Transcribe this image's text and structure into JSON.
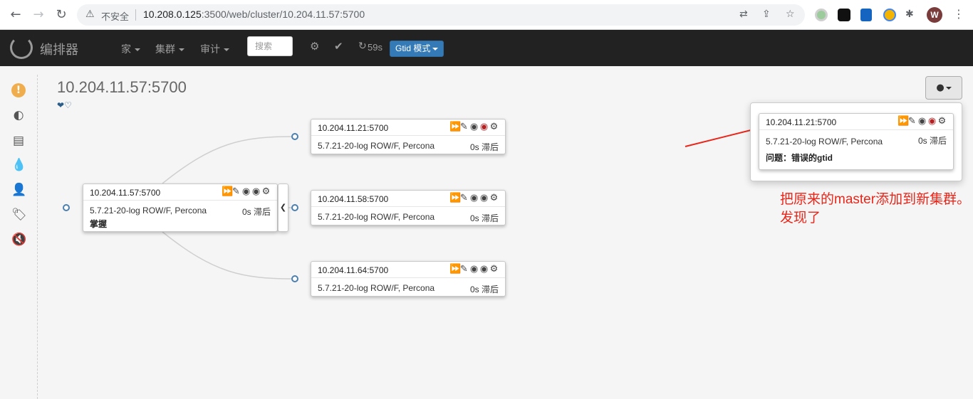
{
  "browser": {
    "insecure_label": "不安全",
    "url_host": "10.208.0.125",
    "url_path": ":3500/web/cluster/10.204.11.57:5700",
    "avatar_letter": "W"
  },
  "navbar": {
    "brand": "编排器",
    "menu_home": "家",
    "menu_clusters": "集群",
    "menu_audit": "审计",
    "search_placeholder": "搜索",
    "refresh_countdown": "59s",
    "gtid_mode": "Gtid 模式"
  },
  "page": {
    "title": "10.204.11.57:5700",
    "hearts": "❤♡"
  },
  "instances": [
    {
      "host": "10.204.11.57:5700",
      "version": "5.7.21-20-log ROW/F, Percona",
      "lag": "0s 滞后",
      "note": "掌握"
    },
    {
      "host": "10.204.11.21:5700",
      "version": "5.7.21-20-log ROW/F, Percona",
      "lag": "0s 滞后"
    },
    {
      "host": "10.204.11.58:5700",
      "version": "5.7.21-20-log ROW/F, Percona",
      "lag": "0s 滞后"
    },
    {
      "host": "10.204.11.64:5700",
      "version": "5.7.21-20-log ROW/F, Percona",
      "lag": "0s 滞后"
    }
  ],
  "problem_popover": {
    "host": "10.204.11.21:5700",
    "version": "5.7.21-20-log ROW/F, Percona",
    "lag": "0s 滞后",
    "problem": "问题：错误的gtid"
  },
  "annotation": {
    "text": "把原来的master添加到新集群。发现了",
    "color": "#e8261a"
  },
  "colors": {
    "navbar_bg": "#222222",
    "gtid_button": "#337ab7",
    "warning_icon": "#f0ad4e",
    "danger_icon": "#b22222"
  }
}
